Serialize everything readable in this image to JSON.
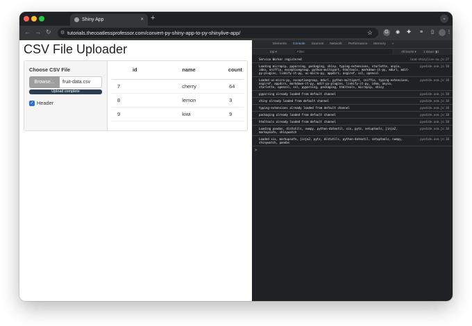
{
  "browser": {
    "tab_title": "Shiny App",
    "tab_close": "×",
    "new_tab": "+",
    "url": "tutorials.thecoatlessprofessor.com/convert-py-shiny-app-to-py-shinylive-app/",
    "icons": [
      "back-arrow-icon",
      "forward-arrow-icon",
      "reload-icon",
      "bookmark-star-icon",
      "extension-icon",
      "profile-icon"
    ]
  },
  "app": {
    "title": "CSV File Uploader",
    "file_input": {
      "label": "Choose CSV File",
      "browse_label": "Browse...",
      "filename": "fruit-data.csv",
      "progress_text": "Upload complete",
      "progress": 1.0
    },
    "header_checkbox": {
      "label": "Header",
      "checked": true
    },
    "table": {
      "columns": [
        "id",
        "name",
        "count"
      ],
      "rows": [
        {
          "id": "7",
          "name": "cherry",
          "count": "64"
        },
        {
          "id": "8",
          "name": "lemon",
          "count": "3"
        },
        {
          "id": "9",
          "name": "kiwi",
          "count": "9"
        }
      ]
    }
  },
  "devtools": {
    "tabs": [
      "Elements",
      "Console",
      "Sources",
      "Network",
      "Performance",
      "Memory",
      "»"
    ],
    "active_tab": "Console",
    "context": "top ▾",
    "filter_placeholder": "Filter",
    "levels": "All levels ▾",
    "issues": "1 Issue: ▮1",
    "logs": [
      {
        "text": "Service Worker registered",
        "source": "load-shinylive-sw.js:27"
      },
      {
        "text": "Loading micropip, pyparsing, packaging, shiny, typing-extensions, starlette, anyio, idna, sniffio, exceptiongroup, python-multipart, htmltools, markdown-it-py, mdurl, mdit-py-plugins, linkify-it-py, uc-micro-py, appdirs, asgiref, ssl, openssl",
        "source": "pyodide.asm.js:10"
      },
      {
        "text": "Loaded uc-micro-py, exceptiongroup, mdurl, python-multipart, sniffio, typing-extensions, asgiref, appdirs, markdown-it-py, mdit-py-plugins, linkify-it-py, idna, anyio, starlette, openssl, ssl, pyparsing, packaging, htmltools, micropip, shiny",
        "source": "pyodide.asm.js:10"
      },
      {
        "text": "pyparsing already loaded from default channel",
        "source": "pyodide.asm.js:10"
      },
      {
        "text": "shiny already loaded from default channel",
        "source": "pyodide.asm.js:10"
      },
      {
        "text": "typing-extensions already loaded from default channel",
        "source": "pyodide.asm.js:10"
      },
      {
        "text": "packaging already loaded from default channel",
        "source": "pyodide.asm.js:10"
      },
      {
        "text": "htmltools already loaded from default channel",
        "source": "pyodide.asm.js:10"
      },
      {
        "text": "Loading pandas, distutils, numpy, python-dateutil, six, pytz, setuptools, jinja2, markupsafe, shinywatch",
        "source": "pyodide.asm.js:10"
      },
      {
        "text": "Loaded six, markupsafe, jinja2, pytz, distutils, python-dateutil, setuptools, numpy, shinywatch, pandas",
        "source": "pyodide.asm.js:10"
      }
    ],
    "prompt": ">"
  }
}
